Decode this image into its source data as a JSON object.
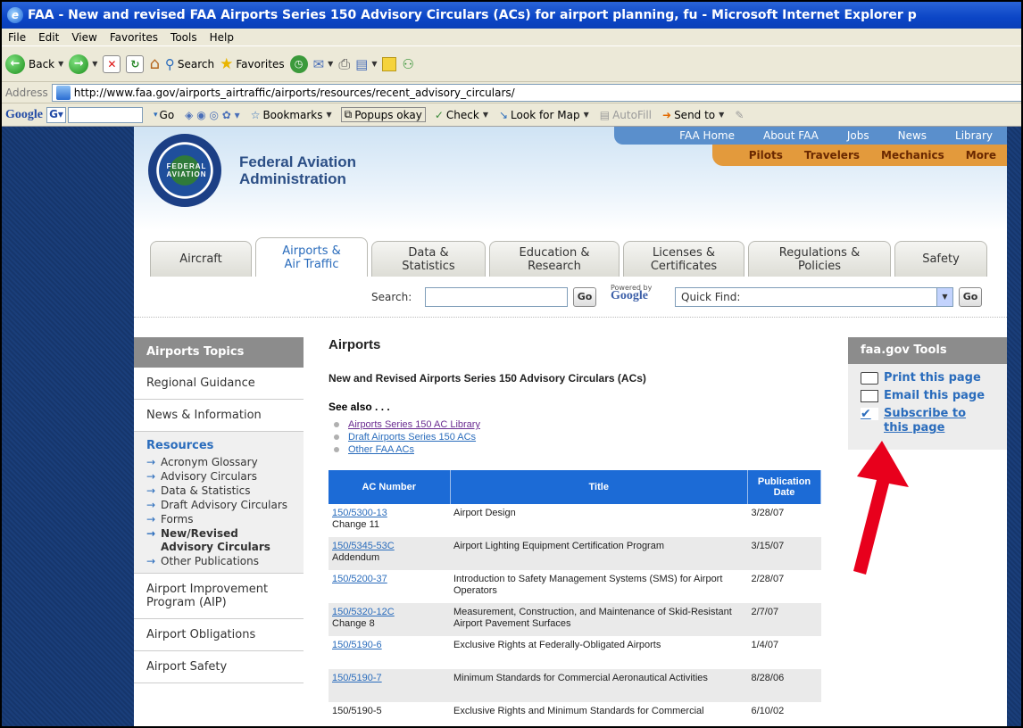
{
  "window": {
    "title": "FAA - New and revised FAA Airports Series 150 Advisory Circulars (ACs) for airport planning, fu - Microsoft Internet Explorer p"
  },
  "menu": [
    "File",
    "Edit",
    "View",
    "Favorites",
    "Tools",
    "Help"
  ],
  "toolbar": {
    "back_label": "Back",
    "search_label": "Search",
    "favorites_label": "Favorites"
  },
  "address": {
    "label": "Address",
    "url": "http://www.faa.gov/airports_airtraffic/airports/resources/recent_advisory_circulars/"
  },
  "googlebar": {
    "logo": "Google",
    "go_label": "Go",
    "bookmarks_label": "Bookmarks",
    "popups_label": "Popups okay",
    "check_label": "Check",
    "map_label": "Look for Map",
    "autofill_label": "AutoFill",
    "sendto_label": "Send to"
  },
  "site": {
    "org_line1": "Federal Aviation",
    "org_line2": "Administration",
    "seal_text": "FEDERAL AVIATION",
    "top_nav": [
      "FAA Home",
      "About FAA",
      "Jobs",
      "News",
      "Library"
    ],
    "audience_nav": [
      "Pilots",
      "Travelers",
      "Mechanics",
      "More"
    ],
    "tabs": [
      {
        "line1": "Aircraft",
        "line2": ""
      },
      {
        "line1": "Airports &",
        "line2": "Air Traffic"
      },
      {
        "line1": "Data &",
        "line2": "Statistics"
      },
      {
        "line1": "Education &",
        "line2": "Research"
      },
      {
        "line1": "Licenses &",
        "line2": "Certificates"
      },
      {
        "line1": "Regulations &",
        "line2": "Policies"
      },
      {
        "line1": "Safety",
        "line2": ""
      }
    ],
    "search_label": "Search:",
    "go_label": "Go",
    "powered_by": "Powered by",
    "powered_google": "Google",
    "quick_find": "Quick Find:"
  },
  "leftnav": {
    "heading": "Airports Topics",
    "top_items": [
      "Regional Guidance",
      "News & Information"
    ],
    "resources_heading": "Resources",
    "resources": [
      "Acronym Glossary",
      "Advisory Circulars",
      "Data & Statistics",
      "Draft Advisory Circulars",
      "Forms",
      "New/Revised Advisory Circulars",
      "Other Publications"
    ],
    "bottom_items": [
      "Airport Improvement Program (AIP)",
      "Airport Obligations",
      "Airport Safety"
    ]
  },
  "main": {
    "title": "Airports",
    "subtitle": "New and Revised Airports Series 150 Advisory Circulars (ACs)",
    "see_also": "See also . . .",
    "links": [
      "Airports Series 150 AC Library",
      "Draft Airports Series 150 ACs",
      "Other FAA ACs"
    ],
    "table_headers": [
      "AC Number",
      "Title",
      "Publication Date"
    ],
    "rows": [
      {
        "ac": "150/5300-13",
        "note": "Change 11",
        "title": "Airport Design",
        "date": "3/28/07"
      },
      {
        "ac": "150/5345-53C",
        "note": "Addendum",
        "title": "Airport Lighting Equipment Certification Program",
        "date": "3/15/07"
      },
      {
        "ac": "150/5200-37",
        "note": "",
        "title": "Introduction to Safety Management Systems (SMS) for Airport Operators",
        "date": "2/28/07"
      },
      {
        "ac": "150/5320-12C",
        "note": "Change 8",
        "title": "Measurement, Construction, and Maintenance of Skid-Resistant Airport Pavement Surfaces",
        "date": "2/7/07"
      },
      {
        "ac": "150/5190-6",
        "note": "",
        "title": "Exclusive Rights at Federally-Obligated Airports",
        "date": "1/4/07"
      },
      {
        "ac": "150/5190-7",
        "note": "",
        "title": "Minimum Standards for Commercial Aeronautical Activities",
        "date": "8/28/06"
      },
      {
        "ac": "150/5190-5",
        "note": "",
        "title": "Exclusive Rights and Minimum Standards for Commercial",
        "date": "6/10/02"
      }
    ]
  },
  "tools": {
    "heading": "faa.gov Tools",
    "print": "Print this page",
    "email": "Email this page",
    "subscribe": "Subscribe to this page"
  },
  "colors": {
    "titlebar": "#0b45c6",
    "link": "#2a6cbc",
    "table_header": "#1c6bd6",
    "arrow": "#e8001c"
  }
}
